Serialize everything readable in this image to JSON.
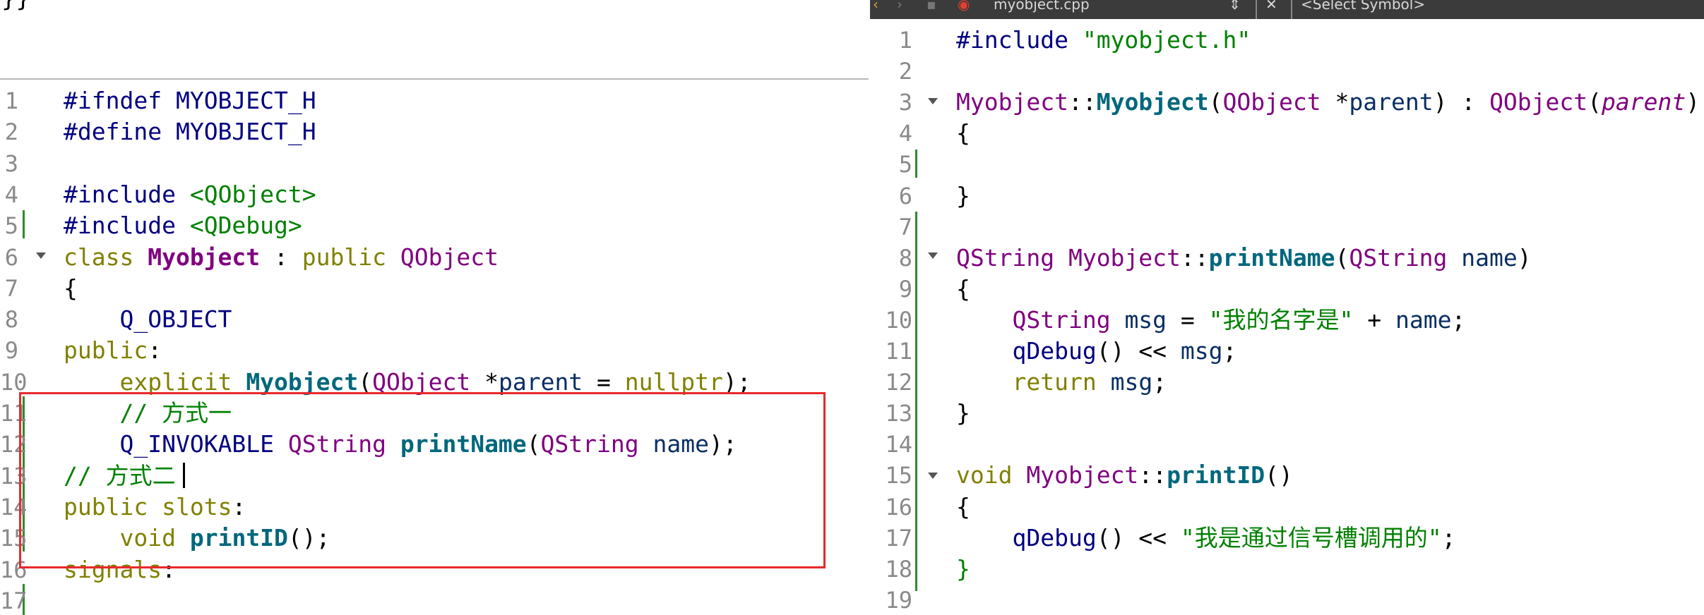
{
  "left_editor": {
    "top_fragment": "}}",
    "lines": [
      {
        "n": "1",
        "parts": [
          [
            "k-pre",
            "#ifndef"
          ],
          [
            "k-plain",
            " "
          ],
          [
            "k-mac",
            "MYOBJECT_H"
          ]
        ]
      },
      {
        "n": "2",
        "parts": [
          [
            "k-pre",
            "#define"
          ],
          [
            "k-plain",
            " "
          ],
          [
            "k-mac",
            "MYOBJECT_H"
          ]
        ]
      },
      {
        "n": "3",
        "parts": []
      },
      {
        "n": "4",
        "parts": [
          [
            "k-pre",
            "#include"
          ],
          [
            "k-plain",
            " "
          ],
          [
            "k-inc",
            "<QObject>"
          ]
        ]
      },
      {
        "n": "5",
        "parts": [
          [
            "k-pre",
            "#include"
          ],
          [
            "k-plain",
            " "
          ],
          [
            "k-inc",
            "<QDebug>"
          ]
        ]
      },
      {
        "n": "6",
        "parts": [
          [
            "k-kw",
            "class"
          ],
          [
            "k-plain",
            " "
          ],
          [
            "k-cls",
            "Myobject"
          ],
          [
            "k-plain",
            " : "
          ],
          [
            "k-kw",
            "public"
          ],
          [
            "k-plain",
            " "
          ],
          [
            "k-type",
            "QObject"
          ]
        ]
      },
      {
        "n": "7",
        "parts": [
          [
            "k-plain",
            "{"
          ]
        ]
      },
      {
        "n": "8",
        "parts": [
          [
            "k-plain",
            "    "
          ],
          [
            "k-mac",
            "Q_OBJECT"
          ]
        ]
      },
      {
        "n": "9",
        "parts": [
          [
            "k-kw",
            "public"
          ],
          [
            "k-plain",
            ":"
          ]
        ]
      },
      {
        "n": "10",
        "parts": [
          [
            "k-plain",
            "    "
          ],
          [
            "k-kw",
            "explicit"
          ],
          [
            "k-plain",
            " "
          ],
          [
            "k-fn",
            "Myobject"
          ],
          [
            "k-plain",
            "("
          ],
          [
            "k-type",
            "QObject"
          ],
          [
            "k-plain",
            " *"
          ],
          [
            "k-id",
            "parent"
          ],
          [
            "k-plain",
            " = "
          ],
          [
            "k-kw",
            "nullptr"
          ],
          [
            "k-plain",
            ");"
          ]
        ]
      },
      {
        "n": "11",
        "parts": [
          [
            "k-plain",
            "    "
          ],
          [
            "k-cm",
            "// 方式一"
          ]
        ]
      },
      {
        "n": "12",
        "parts": [
          [
            "k-plain",
            "    "
          ],
          [
            "k-mac",
            "Q_INVOKABLE"
          ],
          [
            "k-plain",
            " "
          ],
          [
            "k-type",
            "QString"
          ],
          [
            "k-plain",
            " "
          ],
          [
            "k-fn",
            "printName"
          ],
          [
            "k-plain",
            "("
          ],
          [
            "k-type",
            "QString"
          ],
          [
            "k-plain",
            " "
          ],
          [
            "k-id",
            "name"
          ],
          [
            "k-plain",
            ");"
          ]
        ]
      },
      {
        "n": "13",
        "parts": [
          [
            "k-cm",
            "// 方式二"
          ]
        ]
      },
      {
        "n": "14",
        "parts": [
          [
            "k-kw",
            "public"
          ],
          [
            "k-plain",
            " "
          ],
          [
            "k-kw",
            "slots"
          ],
          [
            "k-plain",
            ":"
          ]
        ]
      },
      {
        "n": "15",
        "parts": [
          [
            "k-plain",
            "    "
          ],
          [
            "k-kw",
            "void"
          ],
          [
            "k-plain",
            " "
          ],
          [
            "k-fn",
            "printID"
          ],
          [
            "k-plain",
            "();"
          ]
        ]
      },
      {
        "n": "16",
        "parts": [
          [
            "k-kw",
            "signals"
          ],
          [
            "k-plain",
            ":"
          ]
        ]
      },
      {
        "n": "17",
        "parts": []
      }
    ]
  },
  "right_editor": {
    "toolbar": {
      "filename": "myobject.cpp",
      "symbol": "<Select Symbol>"
    },
    "lines": [
      {
        "n": "1",
        "parts": [
          [
            "k-pre",
            "#include"
          ],
          [
            "k-plain",
            " "
          ],
          [
            "k-str",
            "\"myobject.h\""
          ]
        ]
      },
      {
        "n": "2",
        "parts": []
      },
      {
        "n": "3",
        "parts": [
          [
            "k-type",
            "Myobject"
          ],
          [
            "k-plain",
            "::"
          ],
          [
            "k-fn",
            "Myobject"
          ],
          [
            "k-plain",
            "("
          ],
          [
            "k-type",
            "QObject"
          ],
          [
            "k-plain",
            " *"
          ],
          [
            "k-id",
            "parent"
          ],
          [
            "k-plain",
            ") : "
          ],
          [
            "k-type",
            "QObject"
          ],
          [
            "k-plain",
            "("
          ],
          [
            "k-it",
            "parent"
          ],
          [
            "k-plain",
            ")"
          ]
        ]
      },
      {
        "n": "4",
        "parts": [
          [
            "k-plain",
            "{"
          ]
        ]
      },
      {
        "n": "5",
        "parts": []
      },
      {
        "n": "6",
        "parts": [
          [
            "k-plain",
            "}"
          ]
        ]
      },
      {
        "n": "7",
        "parts": []
      },
      {
        "n": "8",
        "parts": [
          [
            "k-type",
            "QString"
          ],
          [
            "k-plain",
            " "
          ],
          [
            "k-type",
            "Myobject"
          ],
          [
            "k-plain",
            "::"
          ],
          [
            "k-fn",
            "printName"
          ],
          [
            "k-plain",
            "("
          ],
          [
            "k-type",
            "QString"
          ],
          [
            "k-plain",
            " "
          ],
          [
            "k-id",
            "name"
          ],
          [
            "k-plain",
            ")"
          ]
        ]
      },
      {
        "n": "9",
        "parts": [
          [
            "k-plain",
            "{"
          ]
        ]
      },
      {
        "n": "10",
        "parts": [
          [
            "k-plain",
            "    "
          ],
          [
            "k-type",
            "QString"
          ],
          [
            "k-plain",
            " "
          ],
          [
            "k-id",
            "msg"
          ],
          [
            "k-plain",
            " = "
          ],
          [
            "k-str",
            "\"我的名字是\""
          ],
          [
            "k-plain",
            " + "
          ],
          [
            "k-id",
            "name"
          ],
          [
            "k-plain",
            ";"
          ]
        ]
      },
      {
        "n": "11",
        "parts": [
          [
            "k-plain",
            "    "
          ],
          [
            "k-mac",
            "qDebug"
          ],
          [
            "k-plain",
            "() << "
          ],
          [
            "k-id",
            "msg"
          ],
          [
            "k-plain",
            ";"
          ]
        ]
      },
      {
        "n": "12",
        "parts": [
          [
            "k-plain",
            "    "
          ],
          [
            "k-kw",
            "return"
          ],
          [
            "k-plain",
            " "
          ],
          [
            "k-id",
            "msg"
          ],
          [
            "k-plain",
            ";"
          ]
        ]
      },
      {
        "n": "13",
        "parts": [
          [
            "k-plain",
            "}"
          ]
        ]
      },
      {
        "n": "14",
        "parts": []
      },
      {
        "n": "15",
        "parts": [
          [
            "k-kw",
            "void"
          ],
          [
            "k-plain",
            " "
          ],
          [
            "k-type",
            "Myobject"
          ],
          [
            "k-plain",
            "::"
          ],
          [
            "k-fn",
            "printID"
          ],
          [
            "k-plain",
            "()"
          ]
        ]
      },
      {
        "n": "16",
        "parts": [
          [
            "k-plain",
            "{"
          ]
        ]
      },
      {
        "n": "17",
        "parts": [
          [
            "k-plain",
            "    "
          ],
          [
            "k-mac",
            "qDebug"
          ],
          [
            "k-plain",
            "() << "
          ],
          [
            "k-str",
            "\"我是通过信号槽调用的\""
          ],
          [
            "k-plain",
            ";"
          ]
        ]
      },
      {
        "n": "18",
        "parts": [
          [
            "k-str",
            "}"
          ]
        ]
      },
      {
        "n": "19",
        "parts": []
      }
    ]
  }
}
